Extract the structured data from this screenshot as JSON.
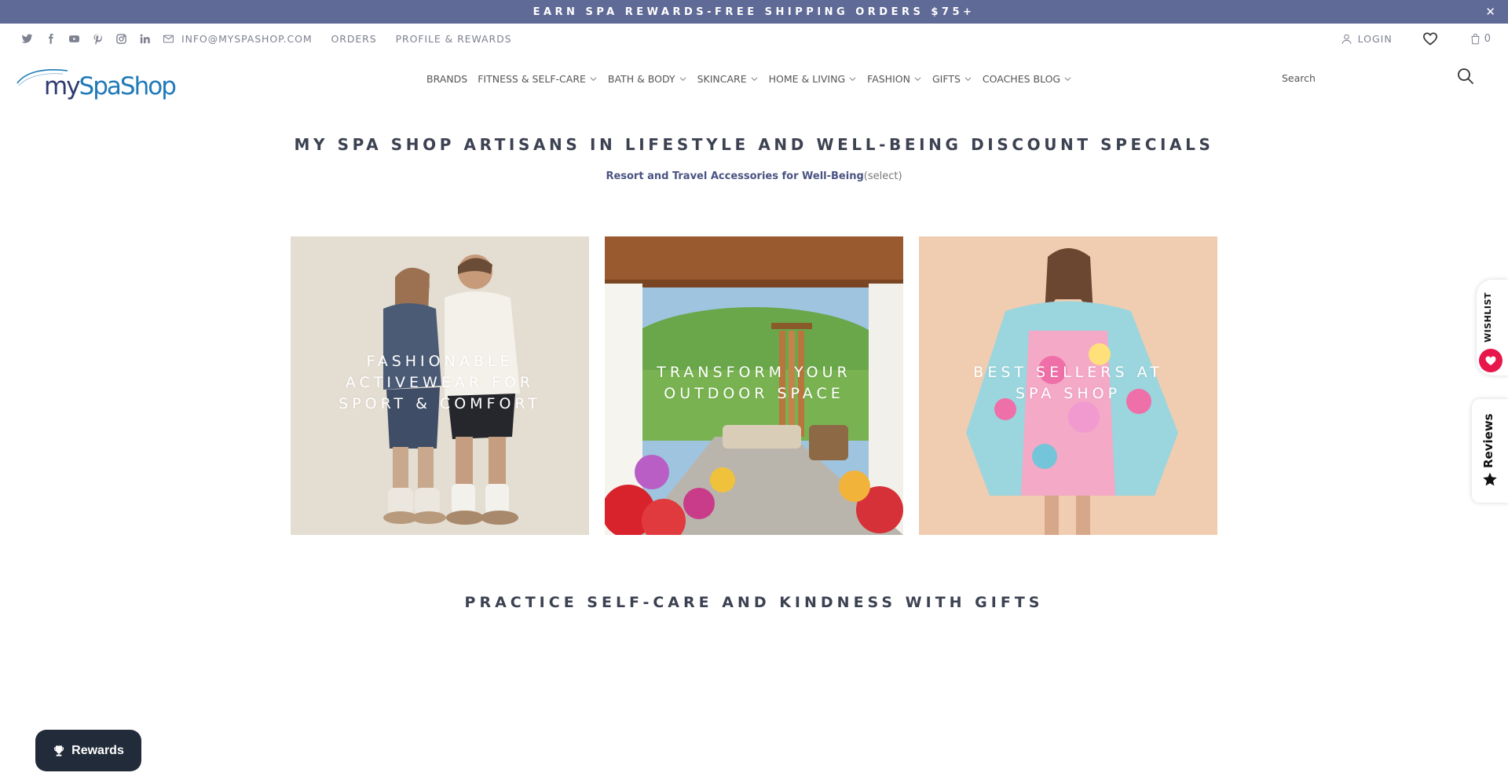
{
  "announcement": {
    "text": "EARN SPA REWARDS-FREE SHIPPING ORDERS $75+",
    "close_glyph": "✕"
  },
  "utility": {
    "social_icons": [
      "twitter-icon",
      "facebook-icon",
      "youtube-icon",
      "pinterest-icon",
      "instagram-icon",
      "linkedin-icon",
      "mail-icon"
    ],
    "email": "INFO@MYSPASHOP.COM",
    "orders": "ORDERS",
    "profile": "PROFILE & REWARDS",
    "login": "LOGIN",
    "cart_count": "0"
  },
  "logo": {
    "my": "my",
    "spa": "SpaShop"
  },
  "nav": {
    "items": [
      {
        "label": "BRANDS",
        "dropdown": false
      },
      {
        "label": "FITNESS & SELF-CARE",
        "dropdown": true
      },
      {
        "label": "BATH & BODY",
        "dropdown": true
      },
      {
        "label": "SKINCARE",
        "dropdown": true
      },
      {
        "label": "HOME & LIVING",
        "dropdown": true
      },
      {
        "label": "FASHION",
        "dropdown": true
      },
      {
        "label": "GIFTS",
        "dropdown": true
      },
      {
        "label": "COACHES BLOG",
        "dropdown": true
      }
    ]
  },
  "search": {
    "placeholder": "Search"
  },
  "main": {
    "title": "MY SPA SHOP ARTISANS IN LIFESTYLE AND WELL-BEING DISCOUNT SPECIALS",
    "sub_link": "Resort and Travel Accessories for Well-Being",
    "sub_select": "(select)",
    "tiles": [
      {
        "caption": "FASHIONABLE ACTIVEWEAR FOR SPORT & COMFORT"
      },
      {
        "caption": "TRANSFORM YOUR OUTDOOR SPACE"
      },
      {
        "caption": "BEST SELLERS AT SPA SHOP"
      }
    ],
    "section_title": "PRACTICE SELF-CARE AND KINDNESS WITH GIFTS"
  },
  "widgets": {
    "wishlist": "WISHLIST",
    "reviews": "Reviews",
    "rewards": "Rewards"
  },
  "colors": {
    "announcement_bg": "#5f6a96",
    "accent_link": "#4a5382",
    "rewards_bg": "#222b3a",
    "wishlist_heart": "#e8174b"
  }
}
